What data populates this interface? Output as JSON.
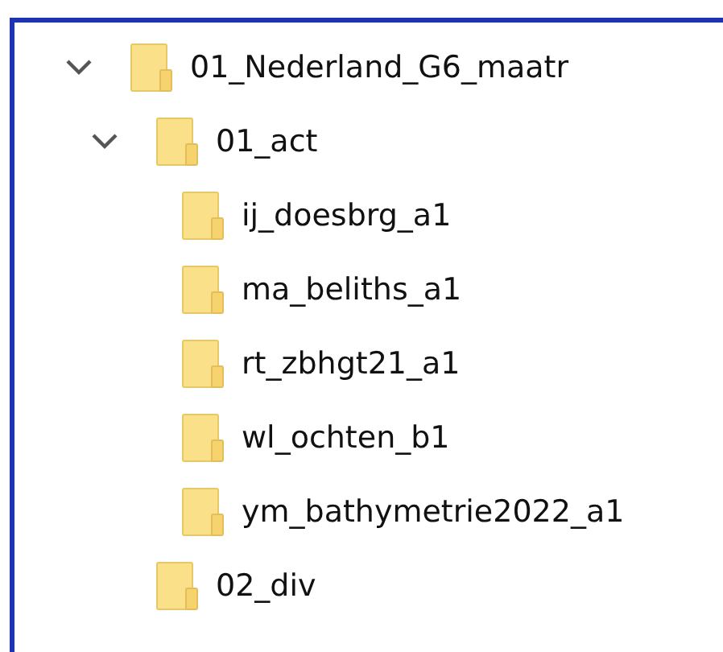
{
  "tree": [
    {
      "label": "01_Nederland_G6_maatr",
      "expanded": true,
      "children": [
        {
          "label": "01_act",
          "expanded": true,
          "children": [
            {
              "label": "ij_doesbrg_a1"
            },
            {
              "label": "ma_beliths_a1"
            },
            {
              "label": "rt_zbhgt21_a1"
            },
            {
              "label": "wl_ochten_b1"
            },
            {
              "label": "ym_bathymetrie2022_a1"
            }
          ]
        },
        {
          "label": "02_div"
        }
      ]
    }
  ]
}
